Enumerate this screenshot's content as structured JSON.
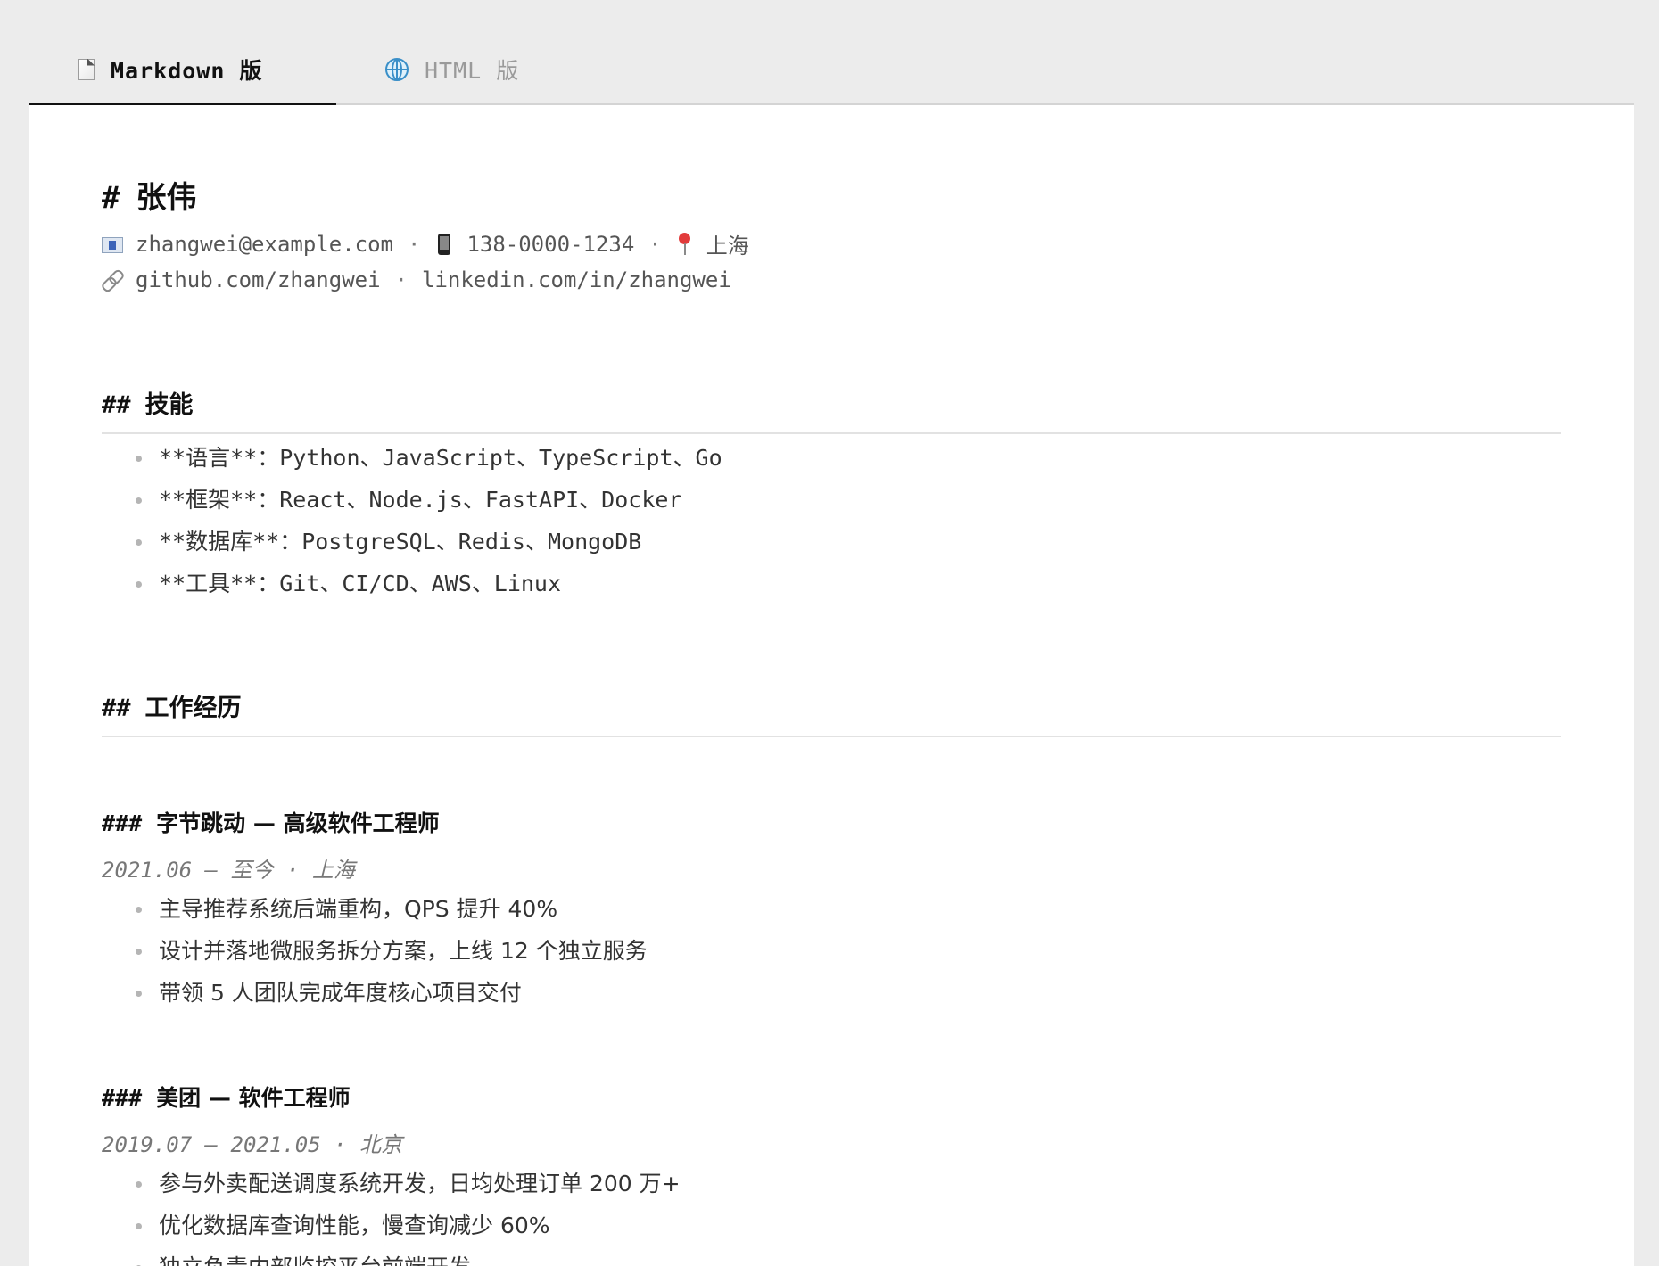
{
  "tabs": [
    {
      "label": "Markdown 版",
      "icon": "document-icon",
      "active": true
    },
    {
      "label": "HTML 版",
      "icon": "globe-icon",
      "active": false
    }
  ],
  "resume": {
    "title_mark": "#",
    "name": "张伟",
    "contact": {
      "email": "zhangwei@example.com",
      "phone": "138-0000-1234",
      "location": "上海",
      "github": "github.com/zhangwei",
      "linkedin": "linkedin.com/in/zhangwei",
      "separator": "·"
    },
    "skills": {
      "heading_mark": "##",
      "heading": "技能",
      "items": [
        "**语言**：Python、JavaScript、TypeScript、Go",
        "**框架**：React、Node.js、FastAPI、Docker",
        "**数据库**：PostgreSQL、Redis、MongoDB",
        "**工具**：Git、CI/CD、AWS、Linux"
      ]
    },
    "experience": {
      "heading_mark": "##",
      "heading": "工作经历",
      "jobs": [
        {
          "heading_mark": "###",
          "title": "字节跳动 — 高级软件工程师",
          "meta": "2021.06 — 至今 · 上海",
          "bullets": [
            "主导推荐系统后端重构，QPS 提升 40%",
            "设计并落地微服务拆分方案，上线 12 个独立服务",
            "带领 5 人团队完成年度核心项目交付"
          ]
        },
        {
          "heading_mark": "###",
          "title": "美团 — 软件工程师",
          "meta": "2019.07 — 2021.05 · 北京",
          "bullets": [
            "参与外卖配送调度系统开发，日均处理订单 200 万+",
            "优化数据库查询性能，慢查询减少 60%",
            "独立负责内部监控平台前端开发"
          ]
        }
      ]
    }
  },
  "colors": {
    "background": "#ececec",
    "panel": "#ffffff",
    "active_tab": "#111111",
    "inactive_tab": "#9a9a9a",
    "muted_text": "#777777"
  }
}
